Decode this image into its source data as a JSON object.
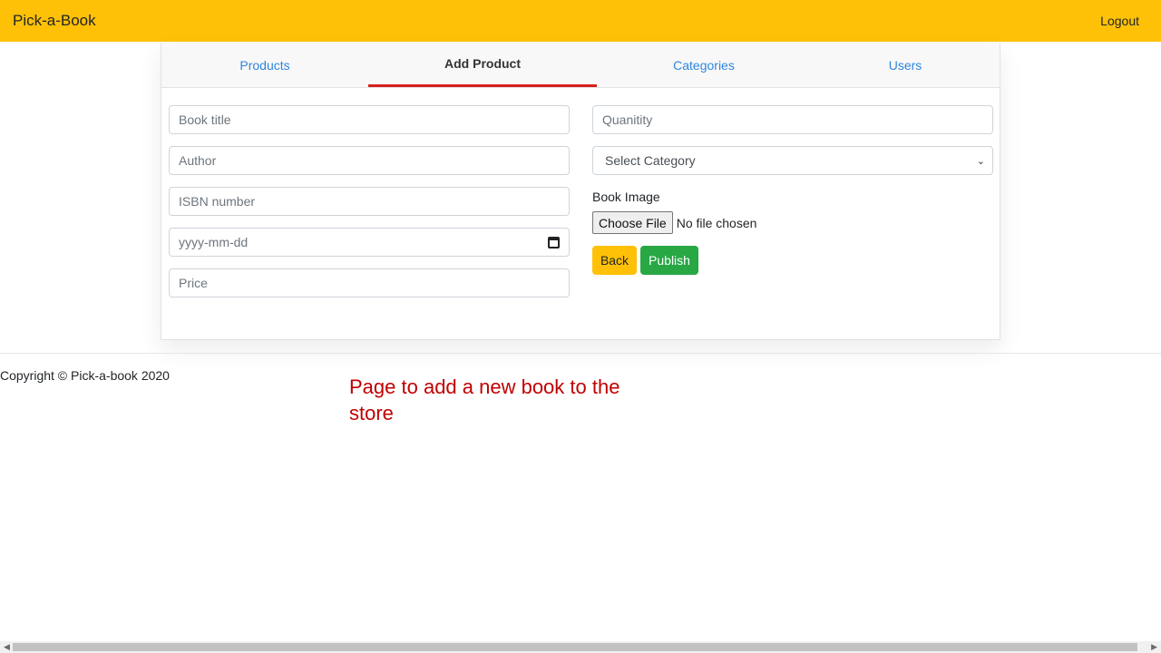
{
  "navbar": {
    "brand": "Pick-a-Book",
    "logout": "Logout"
  },
  "tabs": [
    {
      "label": "Products",
      "active": false
    },
    {
      "label": "Add Product",
      "active": true
    },
    {
      "label": "Categories",
      "active": false
    },
    {
      "label": "Users",
      "active": false
    }
  ],
  "form": {
    "book_title_placeholder": "Book title",
    "author_placeholder": "Author",
    "isbn_placeholder": "ISBN number",
    "date_placeholder": "yyyy-mm-dd",
    "price_placeholder": "Price",
    "quantity_placeholder": "Quanitity",
    "category_selected": "Select Category",
    "image_label": "Book Image",
    "choose_file_label": "Choose File",
    "file_status": "No file chosen",
    "back_label": "Back",
    "publish_label": "Publish"
  },
  "footer": {
    "copyright": "Copyright © Pick-a-book 2020"
  },
  "annotation": "Page to add a new book to the store",
  "colors": {
    "navbar": "#ffc107",
    "active_tab_underline": "#d6201f",
    "tab_link": "#2f86e0",
    "publish": "#28a745",
    "annotation": "#c00000"
  }
}
